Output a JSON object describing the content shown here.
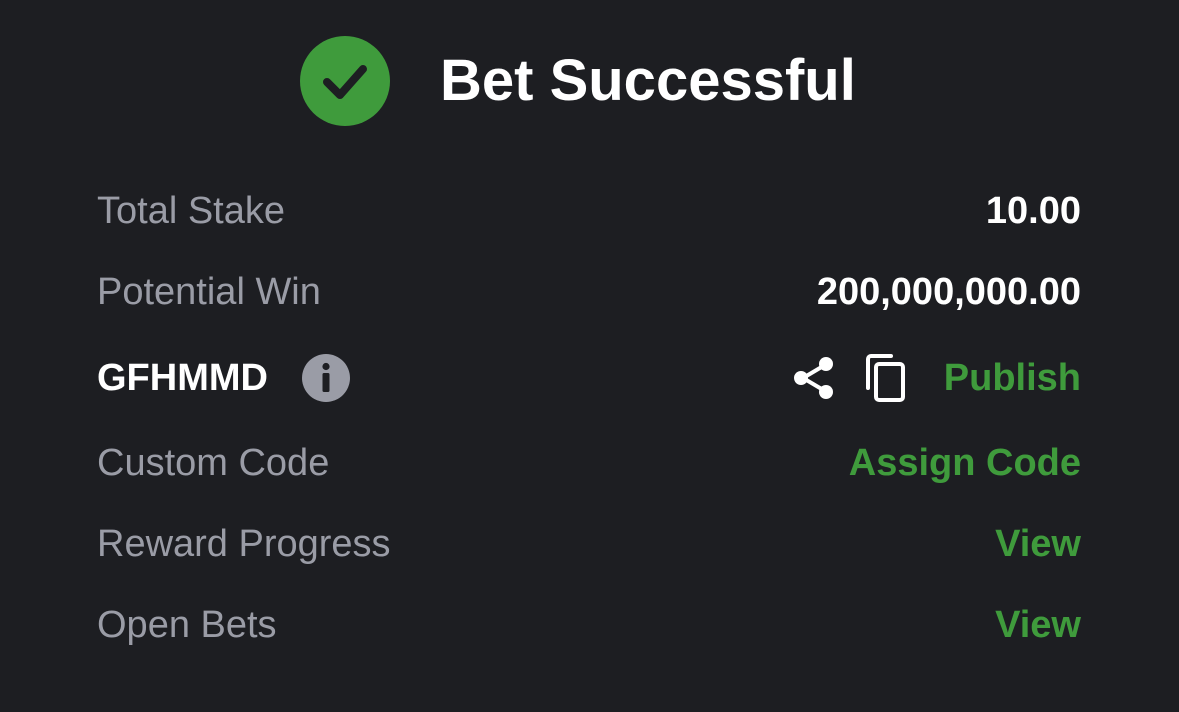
{
  "header": {
    "title": "Bet Successful",
    "success_color": "#3f9b3c",
    "icon": "check-circle-icon"
  },
  "summary": {
    "total_stake_label": "Total Stake",
    "total_stake_value": "10.00",
    "potential_win_label": "Potential Win",
    "potential_win_value": "200,000,000.00"
  },
  "booking": {
    "code": "GFHMMD",
    "info_icon": "info-icon",
    "share_icon": "share-icon",
    "copy_icon": "copy-icon",
    "publish_label": "Publish"
  },
  "links": {
    "custom_code_label": "Custom Code",
    "custom_code_action": "Assign Code",
    "reward_progress_label": "Reward Progress",
    "reward_progress_action": "View",
    "open_bets_label": "Open Bets",
    "open_bets_action": "View"
  },
  "colors": {
    "background": "#1d1e22",
    "label_gray": "#9a9ca6",
    "accent_green": "#3f9b3c",
    "text_white": "#ffffff"
  }
}
